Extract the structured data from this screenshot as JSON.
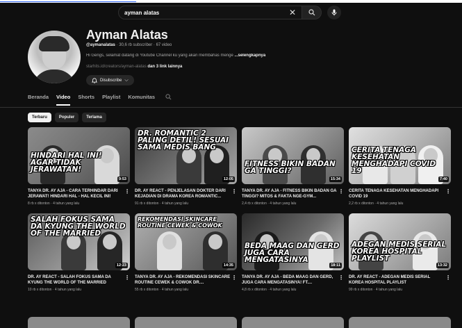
{
  "search": {
    "value": "ayman alatas",
    "placeholder": ""
  },
  "channel": {
    "name": "Ayman Alatas",
    "handle": "@aymanalatas",
    "stats": "· 30,6 rb subscriber · 67 video",
    "description": "Hi Gengs, selamat datang di Youtube Channel ku yang akan membahas menge",
    "description_more": "...selengkapnya",
    "link": "starhits.id/creators/ayman-alatas",
    "link_more": "dan 3 link lainnya",
    "subscribe_label": "Disubscribe"
  },
  "tabs": [
    "Beranda",
    "Video",
    "Shorts",
    "Playlist",
    "Komunitas"
  ],
  "chips": [
    "Terbaru",
    "Populer",
    "Terlama"
  ],
  "videos": [
    {
      "title": "TANYA DR. AY AJA - CARA TERHINDAR DARI JERAWAT! HINDARI HAL - HAL KECIL INI!",
      "meta": "8 rb x ditonton · 4 tahun yang lalu",
      "duration": "9:53",
      "headline": "HINDARI HAL INI! AGAR TIDAK JERAWATAN!"
    },
    {
      "title": "DR. AY REACT - PENJELASAN DOKTER DARI KEJADIAN DI DRAMA KOREA ROMANTIC...",
      "meta": "91 rb x ditonton · 4 tahun yang lalu",
      "duration": "12:05",
      "headline": "DR. ROMANTIC 2 PALING DETIL! SESUAI SAMA MEDIS BANG"
    },
    {
      "title": "TANYA DR. AY AJA - FITNESS BIKIN BADAN GA TINGGI? MITOS & FAKTA NGE-GYM...",
      "meta": "2,4 rb x ditonton · 4 tahun yang lalu",
      "duration": "15:34",
      "headline": "FITNESS BIKIN BADAN GA TINGGI?"
    },
    {
      "title": "CERITA TENAGA KESEHATAN MENGHADAPI COVID 19",
      "meta": "2,2 rb x ditonton · 4 tahun yang lalu",
      "duration": "7:40",
      "headline": "CERITA TENAGA KESEHATAN MENGHADAPI COVID 19"
    },
    {
      "title": "DR. AY REACT - SALAH FOKUS SAMA DA KYUNG THE WORLD OF THE MARRIED",
      "meta": "10 rb x ditonton · 4 tahun yang lalu",
      "duration": "12:23",
      "headline": "SALAH FOKUS SAMA DA KYUNG THE WORLD OF THE MARRIED"
    },
    {
      "title": "TANYA DR. AY AJA - REKOMENDASI SKINCARE ROUTINE CEWEK & COWOK DR....",
      "meta": "55 rb x ditonton · 4 tahun yang lalu",
      "duration": "14:35",
      "headline": "REKOMENDASI SKINCARE ROUTINE CEWEK & COWOK"
    },
    {
      "title": "TANYA DR. AY AJA - BEDA MAAG DAN GERD, JUGA CARA MENGATASINYA! FT....",
      "meta": "4,8 rb x ditonton · 4 tahun yang lalu",
      "duration": "18:11",
      "headline": "BEDA MAAG DAN GERD JUGA CARA MENGATASINYA"
    },
    {
      "title": "DR. AY REACT - ADEGAN MEDIS SERIAL KOREA HOSPITAL PLAYLIST",
      "meta": "99 rb x ditonton · 4 tahun yang lalu",
      "duration": "13:32",
      "headline": "ADEGAN MEDIS SERIAL KOREA HOSPITAL PLAYLIST"
    }
  ]
}
